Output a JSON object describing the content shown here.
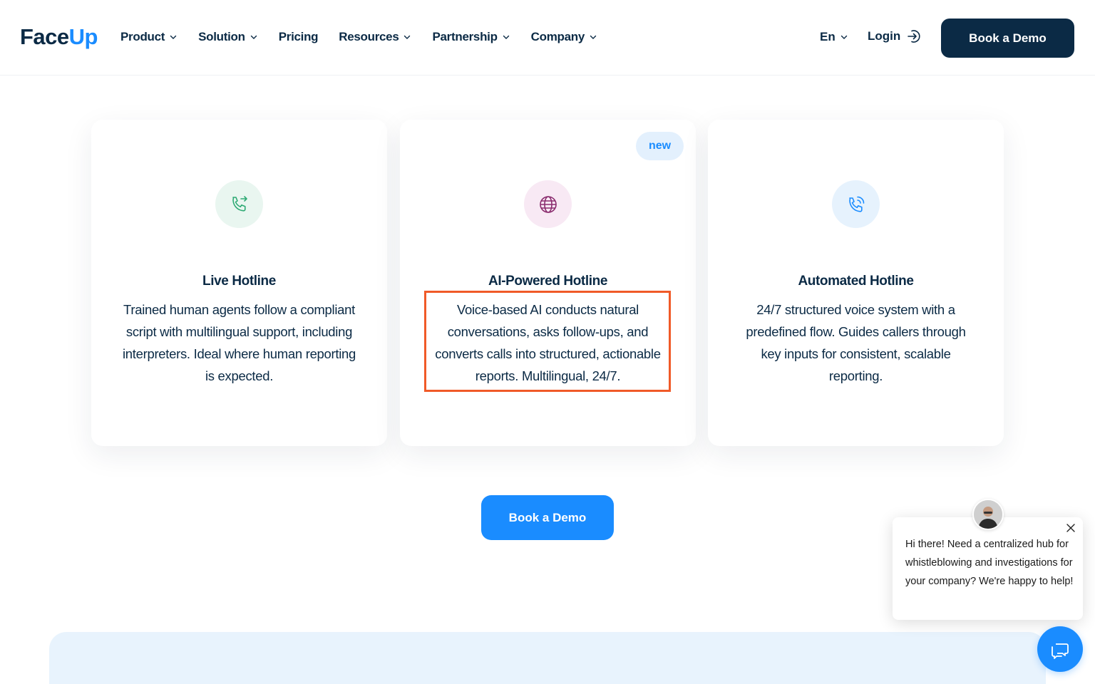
{
  "header": {
    "logo_text": "Face",
    "logo_accent": "Up",
    "nav": [
      {
        "label": "Product",
        "has_dropdown": true
      },
      {
        "label": "Solution",
        "has_dropdown": true
      },
      {
        "label": "Pricing",
        "has_dropdown": false
      },
      {
        "label": "Resources",
        "has_dropdown": true
      },
      {
        "label": "Partnership",
        "has_dropdown": true
      },
      {
        "label": "Company",
        "has_dropdown": true
      }
    ],
    "language": "En",
    "login_label": "Login",
    "cta_label": "Book a Demo"
  },
  "cards": [
    {
      "title": "Live Hotline",
      "description": "Trained human agents follow a compliant script with multilingual support, including interpreters. Ideal where human reporting is expected.",
      "icon": "phone-forward-icon"
    },
    {
      "title": "AI-Powered Hotline",
      "description": "Voice-based AI conducts natural conversations, asks follow-ups, and converts calls into structured, actionable reports. Multilingual, 24/7.",
      "icon": "globe-icon",
      "badge": "new"
    },
    {
      "title": "Automated Hotline",
      "description": "24/7 structured voice system with a predefined flow. Guides callers through key inputs for consistent, scalable reporting.",
      "icon": "phone-ringing-icon"
    }
  ],
  "cta_center_label": "Book a Demo",
  "chat": {
    "message": "Hi there! Need a centralized hub for whistleblowing and investigations for your company? We're happy to help!"
  },
  "colors": {
    "navy": "#0b2a45",
    "primary_blue": "#1a8cff",
    "highlight_orange": "#f05a28"
  }
}
